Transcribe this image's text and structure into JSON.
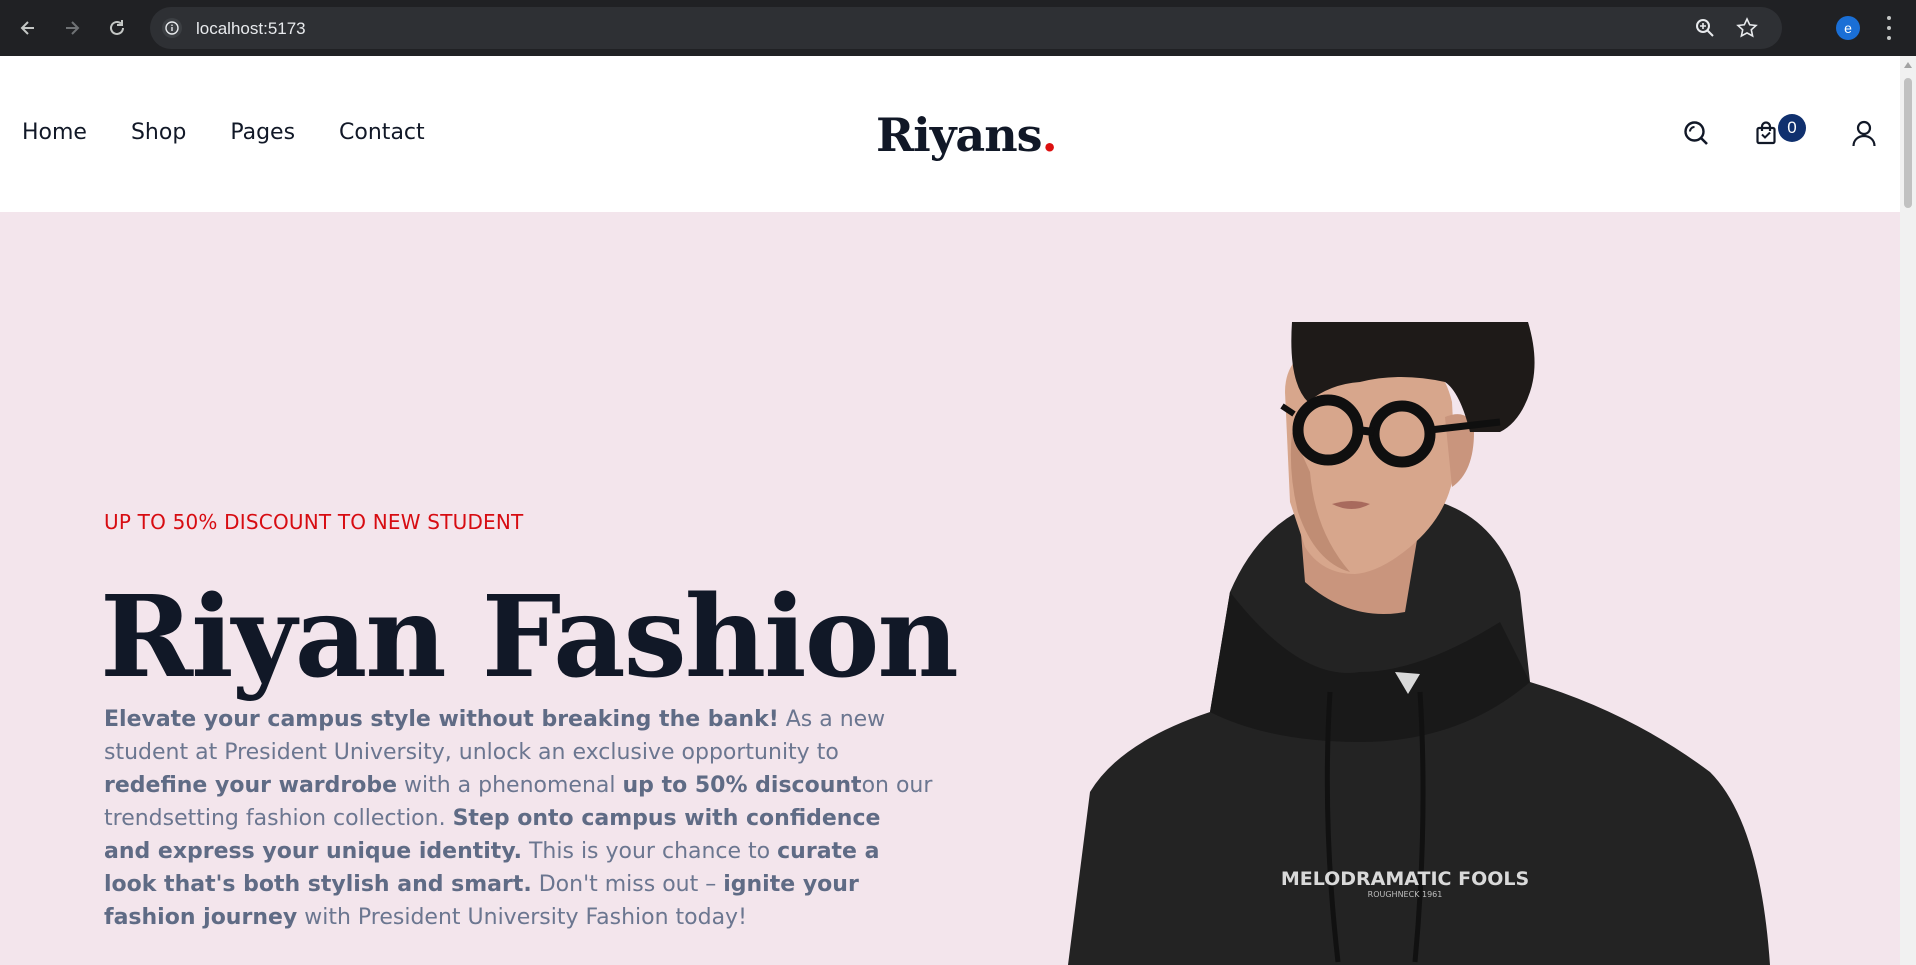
{
  "browser": {
    "url": "localhost:5173",
    "profile_initial": "e"
  },
  "nav": {
    "items": [
      {
        "label": "Home"
      },
      {
        "label": "Shop"
      },
      {
        "label": "Pages"
      },
      {
        "label": "Contact"
      }
    ]
  },
  "logo": {
    "text": "Riyans",
    "dot": "."
  },
  "header": {
    "cart_count": "0",
    "icons": [
      "search-icon",
      "shopping-bag-icon",
      "user-icon"
    ]
  },
  "hero": {
    "promo": "UP TO 50% DISCOUNT TO NEW STUDENT",
    "title": "Riyan Fashion",
    "desc": [
      {
        "t": "Elevate your campus style without breaking the bank!",
        "b": true
      },
      {
        "t": " As a new student at President University, unlock an exclusive opportunity to ",
        "b": false
      },
      {
        "t": "redefine your wardrobe",
        "b": true
      },
      {
        "t": " with a phenomenal ",
        "b": false
      },
      {
        "t": "up to 50% discount",
        "b": true
      },
      {
        "t": "on our trendsetting fashion collection. ",
        "b": false
      },
      {
        "t": "Step onto campus with confidence and express your unique identity.",
        "b": true
      },
      {
        "t": " This is your chance to ",
        "b": false
      },
      {
        "t": "curate a look that's both stylish and smart.",
        "b": true
      },
      {
        "t": " Don't miss out – ",
        "b": false
      },
      {
        "t": "ignite your fashion journey",
        "b": true
      },
      {
        "t": " with President University Fashion today!",
        "b": false
      }
    ],
    "hoodie_print": "MELODRAMATIC FOOLS",
    "hoodie_subprint": "ROUGHNECK 1961"
  },
  "colors": {
    "hero_bg": "#f3e5ec",
    "accent_red": "#d70c12",
    "navy": "#10306e",
    "text_dark": "#111827"
  }
}
